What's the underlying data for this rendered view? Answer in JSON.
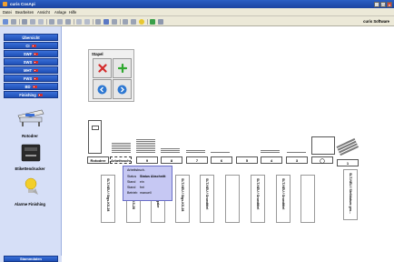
{
  "window": {
    "title": "curis CosApi"
  },
  "menu": {
    "items": [
      "Datei",
      "Bearbeiten",
      "Ansicht",
      "Anlage",
      "Hilfe"
    ]
  },
  "toolbar": {
    "brand": "curis Software"
  },
  "sidebar": {
    "buttons": [
      {
        "label": "Übersicht"
      },
      {
        "label": "CI"
      },
      {
        "label": "SWF"
      },
      {
        "label": "SWS"
      },
      {
        "label": "MHT"
      },
      {
        "label": "FWS"
      },
      {
        "label": "BD"
      },
      {
        "label": "Finishing"
      }
    ],
    "devices": [
      {
        "label": "Rotodrer"
      },
      {
        "label": "Etikettendrucker"
      },
      {
        "label": "Alarme Finishing"
      }
    ],
    "bottom_button": "Stammdaten"
  },
  "stapel": {
    "title": "Stapel"
  },
  "stations": [
    {
      "label": "Rotodrer"
    },
    {
      "label": "Arbeitsschr."
    },
    {
      "label": "9"
    },
    {
      "label": "8"
    },
    {
      "label": "7"
    },
    {
      "label": "6"
    },
    {
      "label": "5"
    },
    {
      "label": "4"
    },
    {
      "label": "3"
    },
    {
      "label": "2"
    },
    {
      "label": "1"
    }
  ],
  "cards": [
    {
      "text": "SLT-NEU / Stgs-KS-28"
    },
    {
      "text": "SL-SV-1 / Aufl-KS-28"
    },
    {
      "text": "SLT-NEU / Ausgabe"
    },
    {
      "text": "SLT-NEU / Stgs-KS-28"
    },
    {
      "text": "SLT-NEU / Grundtitel"
    },
    {
      "text": ""
    },
    {
      "text": "SLT-NEU / Grundtitel"
    },
    {
      "text": "SLT-NEU / Grundtitel"
    },
    {
      "text": ""
    },
    {
      "text": "SLT-NEU / Stelldatum gro..."
    }
  ],
  "popup": {
    "title": "Arbeitsbsch.",
    "rows": [
      {
        "key": "Status",
        "value": "Status Abschnitt"
      },
      {
        "key": "Stand",
        "value": "ein"
      },
      {
        "key": "Stand",
        "value": "frei"
      },
      {
        "key": "Betrieb",
        "value": "manuell"
      }
    ]
  },
  "colors": {
    "accent": "#1f4fb5",
    "sidebar_bg": "#d6dff7",
    "popup_bg": "#c6c8f3",
    "delete": "#d42b2b",
    "add": "#2fa82f"
  }
}
